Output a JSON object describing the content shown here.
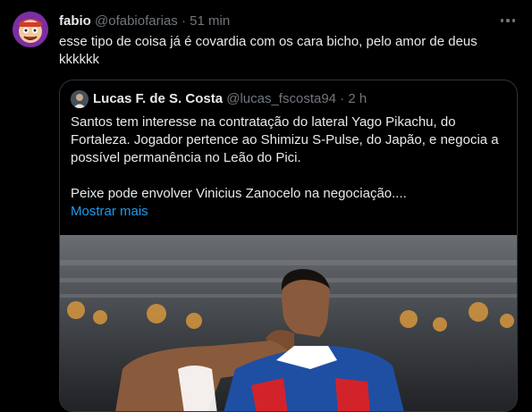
{
  "tweet": {
    "display_name": "fabio",
    "handle": "@ofabiofarias",
    "separator": "·",
    "time": "51 min",
    "text": "esse tipo de coisa já é covardia com os cara bicho, pelo amor de deus kkkkkk"
  },
  "quoted": {
    "display_name": "Lucas F. de S. Costa",
    "handle": "@lucas_fscosta94",
    "separator": "·",
    "time": "2 h",
    "paragraph_1": "Santos tem interesse na contratação do lateral Yago Pikachu, do Fortaleza. Jogador pertence ao Shimizu S-Pulse, do Japão, e negocia a possível permanência no Leão do Pici.",
    "paragraph_2": "Peixe pode envolver Vinicius Zanocelo na negociação....",
    "show_more": "Mostrar mais"
  },
  "icons": {
    "more": "more-horizontal-icon"
  },
  "colors": {
    "background": "#000000",
    "text": "#e7e9ea",
    "secondary": "#71767b",
    "link": "#1d9bf0",
    "border": "#2f3336"
  }
}
